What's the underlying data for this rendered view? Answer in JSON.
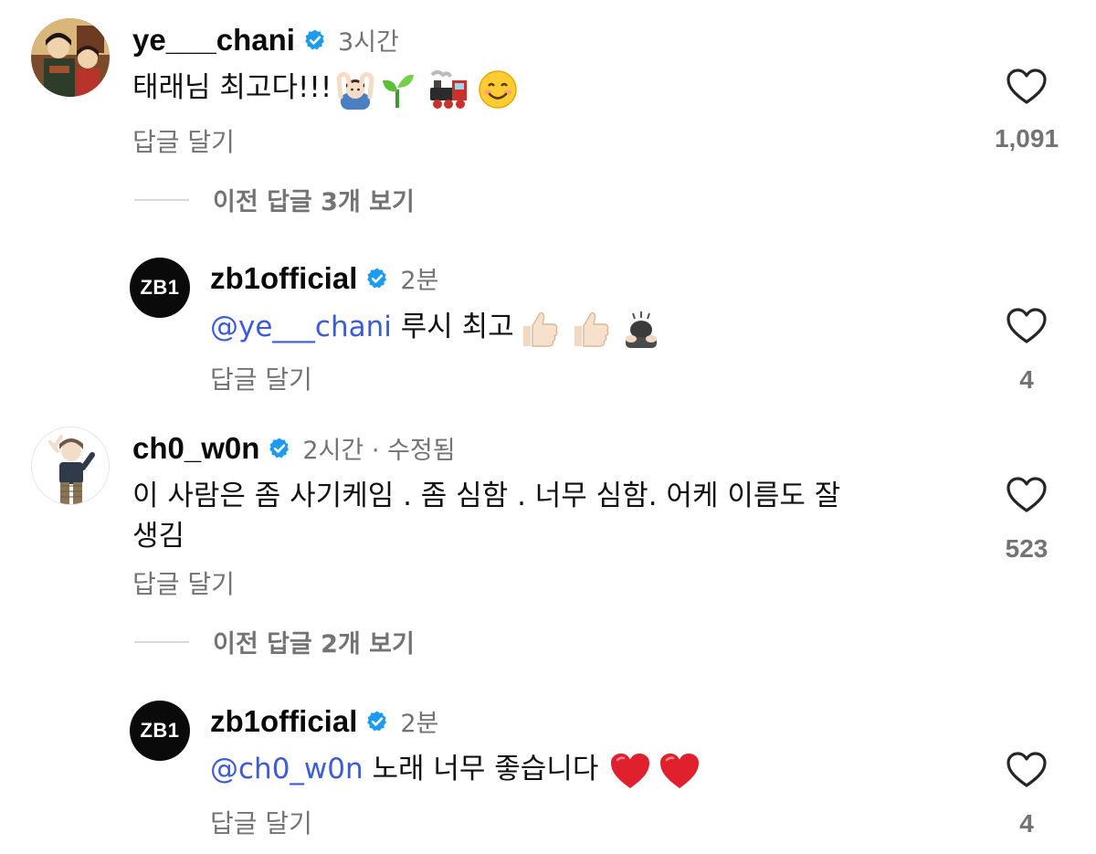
{
  "comments": [
    {
      "username": "ye___chani",
      "time": "3시간",
      "text": "태래님 최고다!!!",
      "reply_label": "답글 달기",
      "likes": "1,091",
      "emojis": [
        "person-gesturing-ok-emoji",
        "seedling-emoji",
        "locomotive-emoji",
        "smiling-face-emoji"
      ],
      "view_replies": "이전 답글 3개 보기",
      "reply": {
        "username": "zb1official",
        "avatar_text": "ZB1",
        "time": "2분",
        "mention": "@ye___chani",
        "text": "루시 최고",
        "emojis": [
          "thumbs-up-emoji",
          "thumbs-up-emoji",
          "person-bowing-emoji"
        ],
        "reply_label": "답글 달기",
        "likes": "4"
      }
    },
    {
      "username": "ch0_w0n",
      "time": "2시간 · 수정됨",
      "text_line1": "이 사람은 좀 사기케임 . 좀 심함 . 너무 심함. 어케 이름도 잘",
      "text_line2": "생김",
      "reply_label": "답글 달기",
      "likes": "523",
      "view_replies": "이전 답글 2개 보기",
      "reply": {
        "username": "zb1official",
        "avatar_text": "ZB1",
        "time": "2분",
        "mention": "@ch0_w0n",
        "text": "노래 너무 좋습니다",
        "emojis": [
          "red-heart-emoji",
          "red-heart-emoji"
        ],
        "reply_label": "답글 달기",
        "likes": "4"
      }
    }
  ],
  "colors": {
    "verified": "#1d9bf0",
    "mention": "#3d5bd6",
    "secondary_text": "#737373"
  }
}
